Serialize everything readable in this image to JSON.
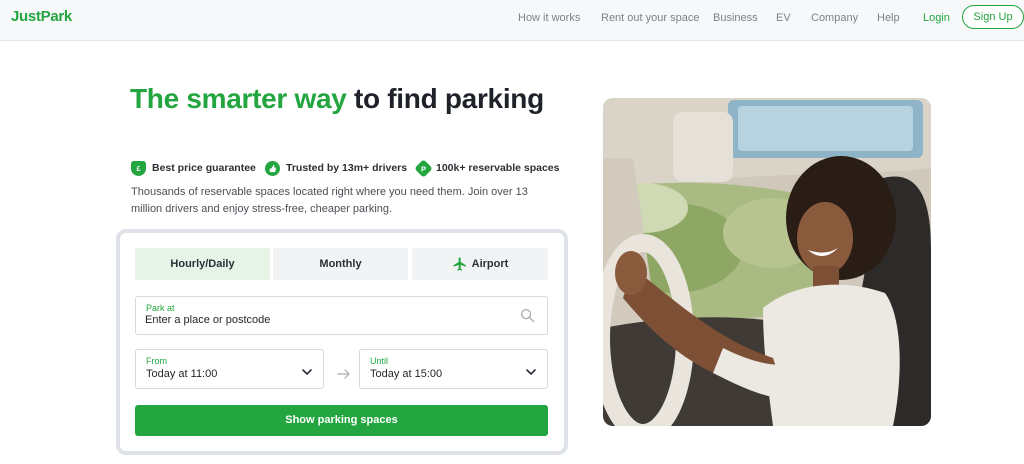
{
  "header": {
    "logo": "JustPark",
    "nav": [
      "How it works",
      "Rent out your space",
      "Business",
      "EV",
      "Company",
      "Help"
    ],
    "login": "Login",
    "signup": "Sign Up"
  },
  "hero": {
    "headline_accent": "The smarter way",
    "headline_rest": " to find parking",
    "features": [
      {
        "icon": "shield-icon",
        "label": "Best price guarantee"
      },
      {
        "icon": "thumbs-up-icon",
        "label": "Trusted by 13m+ drivers"
      },
      {
        "icon": "parking-icon",
        "label": "100k+ reservable spaces"
      }
    ],
    "subtext": "Thousands of reservable spaces located right where you need them. Join over 13 million drivers and enjoy stress-free, cheaper parking."
  },
  "search": {
    "tabs": [
      "Hourly/Daily",
      "Monthly",
      "Airport"
    ],
    "active_tab": "Hourly/Daily",
    "park_at_label": "Park at",
    "park_at_placeholder": "Enter a place or postcode",
    "from_label": "From",
    "from_value": "Today at 11:00",
    "until_label": "Until",
    "until_value": "Today at 15:00",
    "cta": "Show parking spaces"
  },
  "colors": {
    "brand": "#23a53f",
    "brand_tint": "#e6f4e8"
  }
}
